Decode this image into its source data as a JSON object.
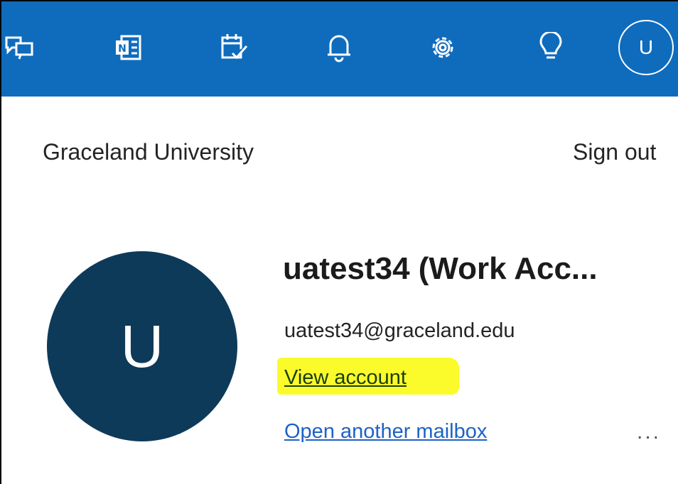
{
  "topbar": {
    "color": "#0f6cbd",
    "icons": [
      "feedback-icon",
      "onenote-icon",
      "my-day-icon",
      "bell-icon",
      "gear-icon",
      "lightbulb-icon"
    ],
    "avatar_initial": "U"
  },
  "panel": {
    "org_name": "Graceland University",
    "sign_out": "Sign out",
    "avatar_initial": "U",
    "display_name": "uatest34 (Work Acc...",
    "email": "uatest34@graceland.edu",
    "view_account": "View account",
    "open_mailbox": "Open another mailbox",
    "more": "...",
    "highlight_color": "#fbfb2c",
    "avatar_color": "#0e3a5a"
  }
}
